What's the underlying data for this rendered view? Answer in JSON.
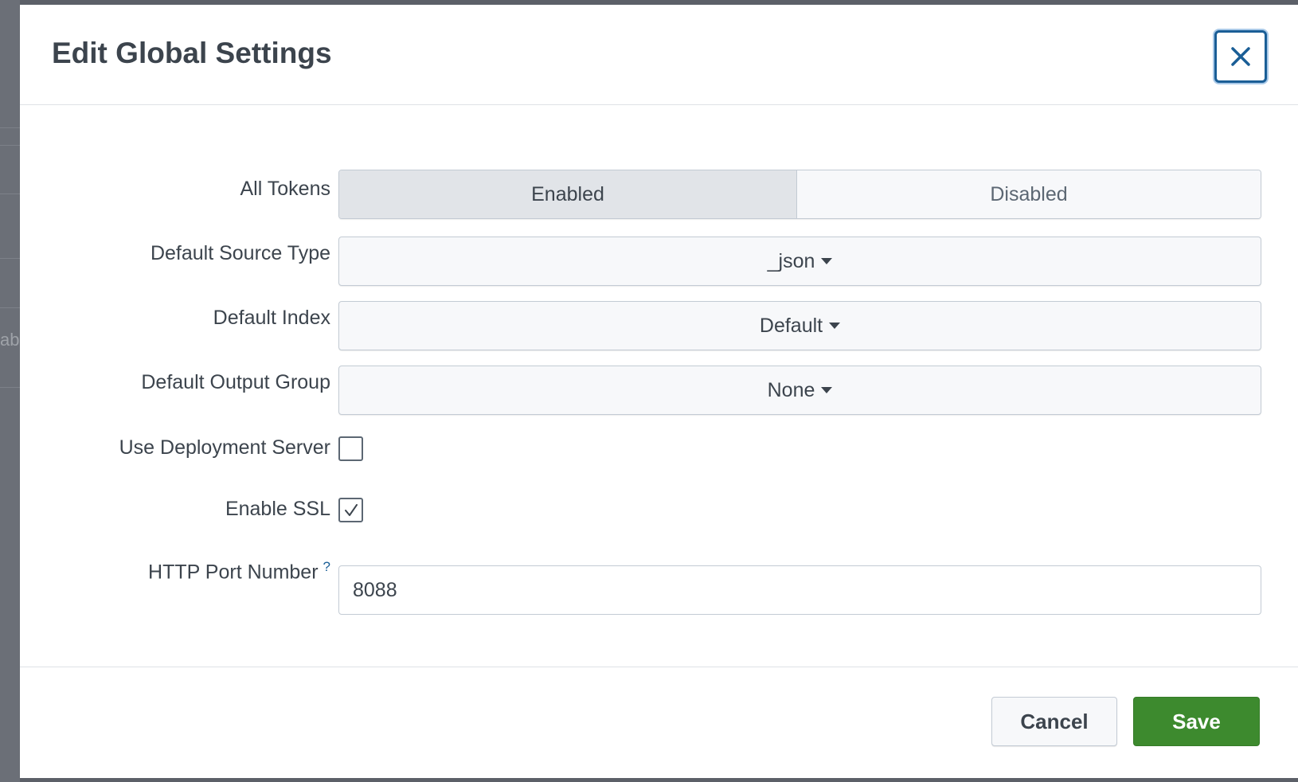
{
  "background": {
    "partial_text": "ab"
  },
  "modal": {
    "title": "Edit Global Settings",
    "close_icon": "close-icon"
  },
  "form": {
    "all_tokens": {
      "label": "All Tokens",
      "options": [
        "Enabled",
        "Disabled"
      ],
      "selected": "Enabled"
    },
    "default_source_type": {
      "label": "Default Source Type",
      "value": "_json"
    },
    "default_index": {
      "label": "Default Index",
      "value": "Default"
    },
    "default_output_group": {
      "label": "Default Output Group",
      "value": "None"
    },
    "use_deployment_server": {
      "label": "Use Deployment Server",
      "checked": false
    },
    "enable_ssl": {
      "label": "Enable SSL",
      "checked": true
    },
    "http_port_number": {
      "label": "HTTP Port Number",
      "help": "?",
      "value": "8088"
    }
  },
  "footer": {
    "cancel_label": "Cancel",
    "save_label": "Save"
  },
  "colors": {
    "accent": "#1a5e96",
    "primary": "#3d8a2e",
    "text": "#3c444d"
  }
}
